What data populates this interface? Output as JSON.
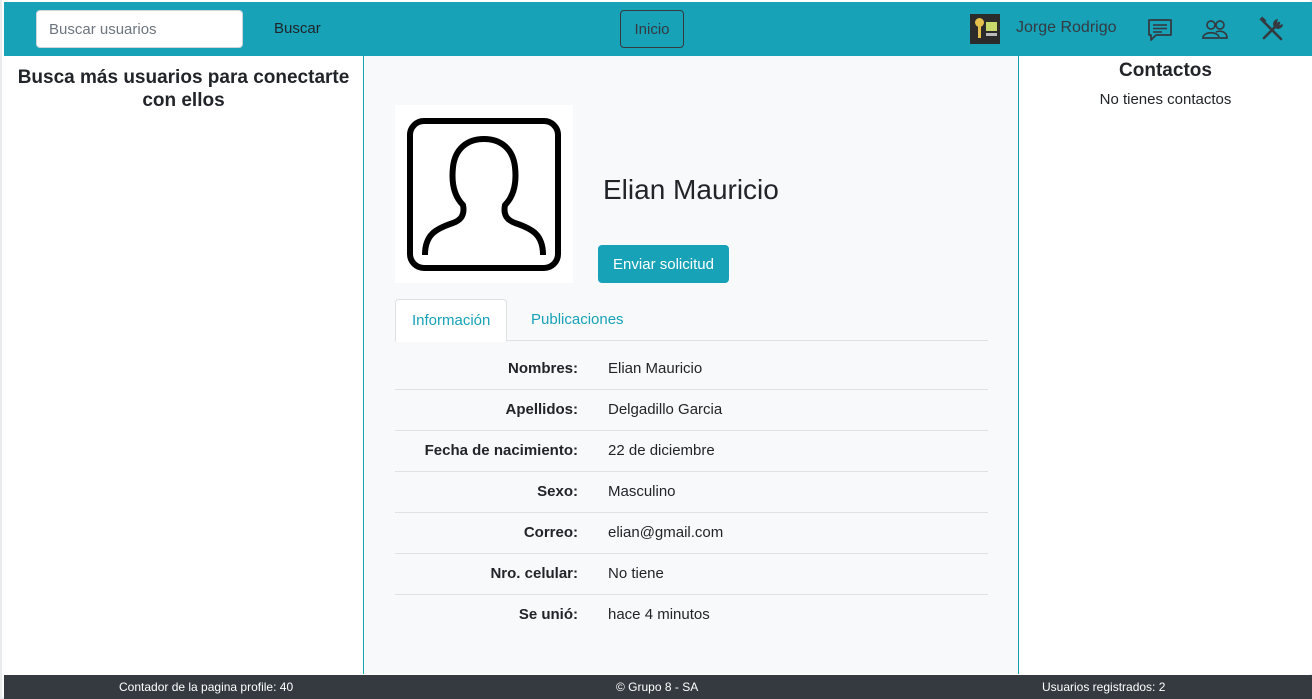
{
  "navbar": {
    "search_placeholder": "Buscar usuarios",
    "search_button": "Buscar",
    "home_button": "Inicio",
    "user_name": "Jorge Rodrigo",
    "icons": [
      "chat-icon",
      "people-icon",
      "tools-icon"
    ],
    "accent_color": "#17a2b8"
  },
  "left": {
    "title": "Busca más usuarios para conectarte con ellos"
  },
  "profile": {
    "name": "Elian Mauricio",
    "request_button": "Enviar solicitud",
    "tabs": [
      {
        "label": "Información",
        "active": true
      },
      {
        "label": "Publicaciones",
        "active": false
      }
    ],
    "info": [
      {
        "label": "Nombres:",
        "value": "Elian Mauricio"
      },
      {
        "label": "Apellidos:",
        "value": "Delgadillo Garcia"
      },
      {
        "label": "Fecha de nacimiento:",
        "value": "22 de diciembre"
      },
      {
        "label": "Sexo:",
        "value": "Masculino"
      },
      {
        "label": "Correo:",
        "value": "elian@gmail.com"
      },
      {
        "label": "Nro. celular:",
        "value": "No tiene"
      },
      {
        "label": "Se unió:",
        "value": "hace 4 minutos"
      }
    ]
  },
  "contacts": {
    "title": "Contactos",
    "empty_text": "No tienes contactos"
  },
  "footer": {
    "counter": "Contador de la pagina profile: 40",
    "copyright": "© Grupo 8 - SA",
    "registered": "Usuarios registrados: 2"
  }
}
